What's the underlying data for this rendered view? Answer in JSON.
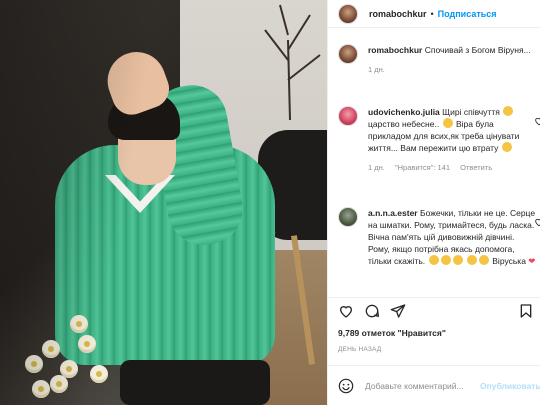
{
  "post": {
    "author": "romabochkur",
    "follow_label": "Подписаться",
    "dot": "•"
  },
  "comments": [
    {
      "user": "romabochkur",
      "text": "Спочивай з Богом Віруня...",
      "time": "1 дн."
    },
    {
      "user": "udovichenko.julia",
      "text_a": "Щирі співчуття",
      "text_b": "царство небесне..",
      "text_c": "Віра була прикладом для всих,як треба цінувати життя...",
      "text_d": "Вам пережити цю втрату",
      "time": "1 дн.",
      "likes": "\"Нравится\": 141",
      "reply": "Ответить"
    },
    {
      "user": "a.n.n.a.ester",
      "text": "Божечки, тільки не це. Серце на шматки. Рому, тримайтеся, будь ласка. Вічна пам'ять цій дивовижній дівчині. Рому, якщо потрібна якась допомога, тільки скажіть.",
      "text_tail": "Віруська"
    }
  ],
  "likes_text": "9,789 отметок \"Нравится\"",
  "timestamp": "ДЕНЬ НАЗАД",
  "add_comment": {
    "placeholder": "Добавьте комментарий...",
    "post_label": "Опубликовать"
  },
  "colors": {
    "link": "#0095f6",
    "text": "#262626",
    "muted": "#8e8e8e"
  },
  "icons": [
    "heart-icon",
    "comment-icon",
    "share-icon",
    "bookmark-icon",
    "emoji-icon"
  ]
}
